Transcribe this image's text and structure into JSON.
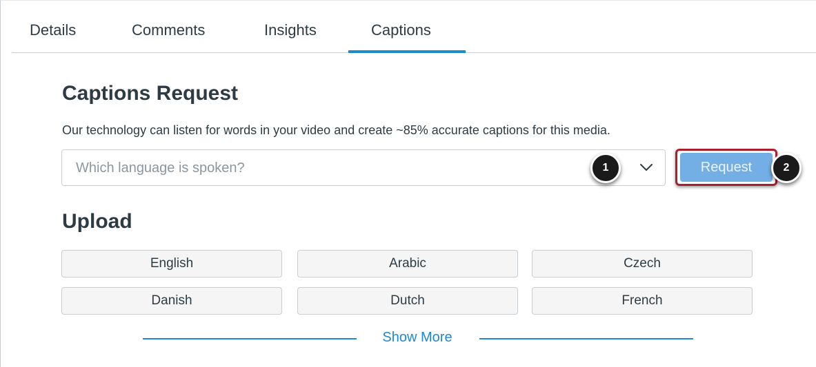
{
  "tabs": [
    {
      "label": "Details",
      "active": false
    },
    {
      "label": "Comments",
      "active": false
    },
    {
      "label": "Insights",
      "active": false
    },
    {
      "label": "Captions",
      "active": true
    }
  ],
  "captions_request": {
    "heading": "Captions Request",
    "description": "Our technology can listen for words in your video and create ~85% accurate captions for this media.",
    "language_select": {
      "placeholder": "Which language is spoken?",
      "value": ""
    },
    "request_button_label": "Request"
  },
  "callouts": [
    "1",
    "2"
  ],
  "upload": {
    "heading": "Upload",
    "languages": [
      "English",
      "Arabic",
      "Czech",
      "Danish",
      "Dutch",
      "French"
    ],
    "show_more_label": "Show More"
  },
  "colors": {
    "accent": "#1e88d3",
    "request_button": "#73aee5",
    "highlight_border": "#a8202e",
    "text": "#2d3b45"
  },
  "icons": {
    "dropdown": "chevron-down-icon"
  }
}
